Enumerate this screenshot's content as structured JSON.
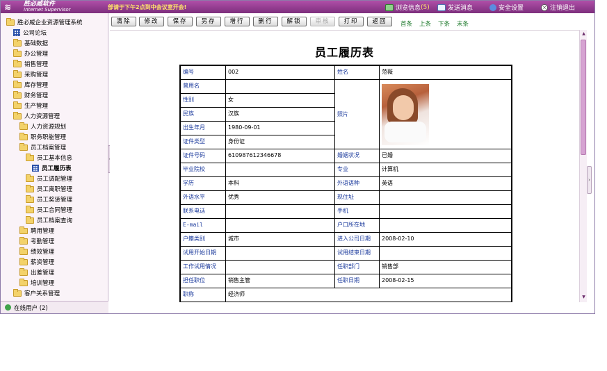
{
  "app": {
    "logo_cn": "胜必威软件",
    "logo_en": "Internet Supervisor",
    "notice": "部请于下午2点到中会议室开会!",
    "links": {
      "browse": "浏览信息",
      "browse_count": "(5)",
      "send": "发送消息",
      "security": "安全设置",
      "logout": "注销退出"
    },
    "colors": {
      "topbar": "#8a3a87",
      "accent": "#b04fa8"
    }
  },
  "sidebar": {
    "items": [
      {
        "label": "胜必威企业资源管理系统",
        "icon": "folder-icon"
      },
      {
        "label": "公司论坛",
        "icon": "grid-icon"
      },
      {
        "label": "基础数据",
        "icon": "folder-icon"
      },
      {
        "label": "办公管理",
        "icon": "folder-icon"
      },
      {
        "label": "销售管理",
        "icon": "folder-icon"
      },
      {
        "label": "采购管理",
        "icon": "folder-icon"
      },
      {
        "label": "库存管理",
        "icon": "folder-icon"
      },
      {
        "label": "财务管理",
        "icon": "folder-icon"
      },
      {
        "label": "生产管理",
        "icon": "folder-icon"
      },
      {
        "label": "人力资源管理",
        "icon": "folder-icon"
      },
      {
        "label": "人力资源规划",
        "icon": "folder-icon"
      },
      {
        "label": "职务职能管理",
        "icon": "folder-icon"
      },
      {
        "label": "员工档案管理",
        "icon": "folder-icon"
      },
      {
        "label": "员工基本信息",
        "icon": "folder-icon"
      },
      {
        "label": "员工履历表",
        "icon": "grid-icon"
      },
      {
        "label": "员工调配管理",
        "icon": "folder-icon"
      },
      {
        "label": "员工离职管理",
        "icon": "folder-icon"
      },
      {
        "label": "员工奖惩管理",
        "icon": "folder-icon"
      },
      {
        "label": "员工合同管理",
        "icon": "folder-icon"
      },
      {
        "label": "员工档案查询",
        "icon": "folder-icon"
      },
      {
        "label": "聘用管理",
        "icon": "folder-icon"
      },
      {
        "label": "考勤管理",
        "icon": "folder-icon"
      },
      {
        "label": "绩效管理",
        "icon": "folder-icon"
      },
      {
        "label": "薪资管理",
        "icon": "folder-icon"
      },
      {
        "label": "出差管理",
        "icon": "folder-icon"
      },
      {
        "label": "培训管理",
        "icon": "folder-icon"
      },
      {
        "label": "客户关系管理",
        "icon": "folder-icon"
      }
    ],
    "online": "在线用户 (2)"
  },
  "toolbar": {
    "buttons": [
      "清除",
      "修改",
      "保存",
      "另存",
      "增行",
      "删行",
      "解锁",
      "审核",
      "打印",
      "返回"
    ],
    "nav": [
      "首条",
      "上条",
      "下条",
      "末条"
    ]
  },
  "page": {
    "title": "员工履历表"
  },
  "resume": {
    "labels": {
      "id": "编号",
      "name": "姓名",
      "former_name": "曾用名",
      "gender": "性别",
      "photo": "照片",
      "ethnic": "民族",
      "birth": "出生年月",
      "cert_type": "证件类型",
      "cert_no": "证件号码",
      "marital": "婚姻状况",
      "school": "毕业院校",
      "major": "专业",
      "education": "学历",
      "language": "外语语种",
      "lang_level": "外语水平",
      "address": "现住址",
      "phone": "联系电话",
      "mobile": "手机",
      "email": "E-mail",
      "hukou_place": "户口所在地",
      "hukou_type": "户籍类别",
      "join_date": "进入公司日期",
      "trial_start": "试用开始日期",
      "trial_end": "试用结束日期",
      "trial_status": "工作试用情况",
      "dept": "任职部门",
      "position": "担任职位",
      "post_date": "任职日期",
      "title": "职称"
    },
    "values": {
      "id": "002",
      "name": "范薇",
      "former_name": "",
      "gender": "女",
      "ethnic": "汉族",
      "birth": "1980-09-01",
      "cert_type": "身份证",
      "cert_no": "610987612346678",
      "marital": "已婚",
      "school": "",
      "major": "计算机",
      "education": "本科",
      "language": "英语",
      "lang_level": "优秀",
      "address": "",
      "phone": "",
      "mobile": "",
      "email": "",
      "hukou_place": "",
      "hukou_type": "城市",
      "join_date": "2008-02-10",
      "trial_start": "",
      "trial_end": "",
      "trial_status": "",
      "dept": "销售部",
      "position": "销售主管",
      "post_date": "2008-02-15",
      "title": "经济师"
    }
  }
}
